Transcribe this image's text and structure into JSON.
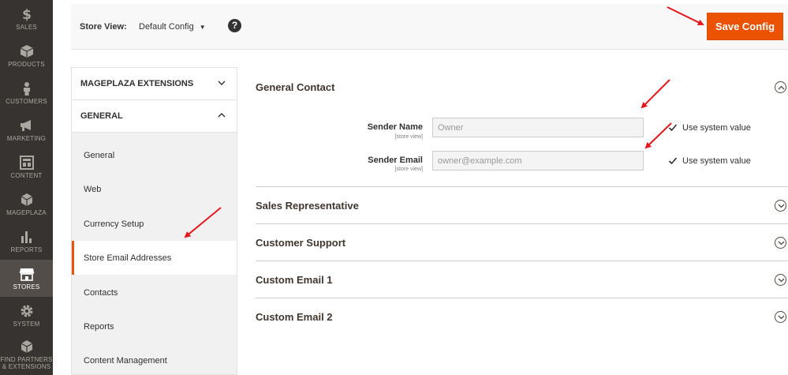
{
  "nav": [
    {
      "label": "SALES",
      "icon": "dollar-icon"
    },
    {
      "label": "PRODUCTS",
      "icon": "box-icon"
    },
    {
      "label": "CUSTOMERS",
      "icon": "person-icon"
    },
    {
      "label": "MARKETING",
      "icon": "megaphone-icon"
    },
    {
      "label": "CONTENT",
      "icon": "layout-icon"
    },
    {
      "label": "MAGEPLAZA",
      "icon": "cube-icon"
    },
    {
      "label": "REPORTS",
      "icon": "bar-chart-icon"
    },
    {
      "label": "STORES",
      "icon": "store-icon"
    },
    {
      "label": "SYSTEM",
      "icon": "gear-icon"
    },
    {
      "label_line1": "FIND PARTNERS",
      "label_line2": "& EXTENSIONS",
      "icon": "box-extension-icon"
    }
  ],
  "topbar": {
    "store_view_label": "Store View:",
    "store_view_value": "Default Config",
    "help_symbol": "?",
    "save_label": "Save Config"
  },
  "sidebar": {
    "groups": [
      {
        "title": "MAGEPLAZA EXTENSIONS"
      },
      {
        "title": "GENERAL"
      }
    ],
    "items": [
      {
        "label": "General"
      },
      {
        "label": "Web"
      },
      {
        "label": "Currency Setup"
      },
      {
        "label": "Store Email Addresses"
      },
      {
        "label": "Contacts"
      },
      {
        "label": "Reports"
      },
      {
        "label": "Content Management"
      }
    ]
  },
  "main": {
    "sections": [
      {
        "title": "General Contact",
        "expanded": true
      },
      {
        "title": "Sales Representative"
      },
      {
        "title": "Customer Support"
      },
      {
        "title": "Custom Email 1"
      },
      {
        "title": "Custom Email 2"
      }
    ],
    "fields": [
      {
        "label": "Sender Name",
        "scope": "[store view]",
        "value": "Owner",
        "checkbox_label": "Use system value"
      },
      {
        "label": "Sender Email",
        "scope": "[store view]",
        "value": "owner@example.com",
        "checkbox_label": "Use system value"
      }
    ]
  },
  "colors": {
    "accent": "#eb5202",
    "nav_bg": "#373330",
    "arrow": "#e8171c"
  }
}
